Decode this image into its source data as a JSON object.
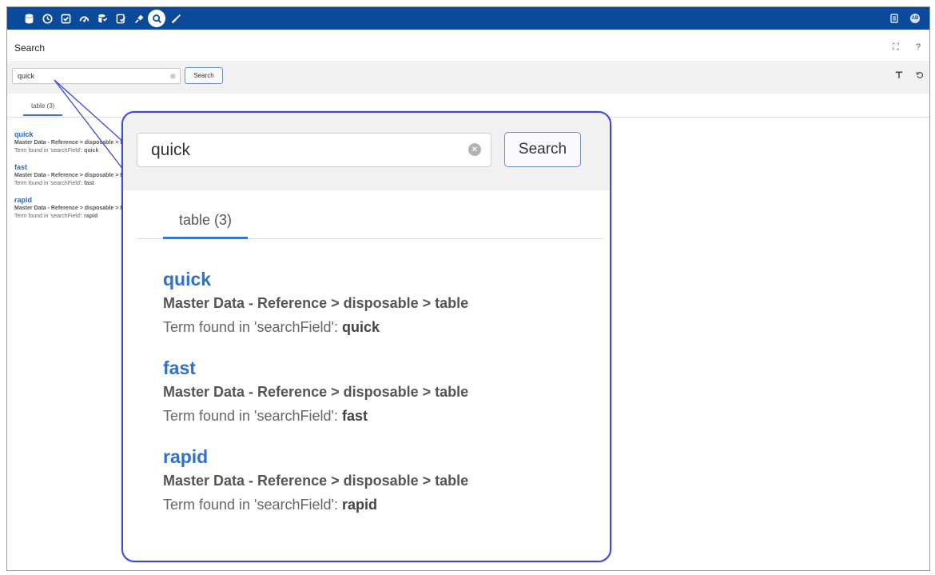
{
  "header": {
    "page_title": "Search",
    "avatar_initials": "AB",
    "nav_icons": [
      "database-icon",
      "clock-icon",
      "checklist-icon",
      "dashboard-icon",
      "data-stack-icon",
      "tasks-icon",
      "plug-icon",
      "search-icon",
      "wrench-icon"
    ],
    "accent": "#0b4a9b"
  },
  "search": {
    "value": "quick",
    "button_label": "Search"
  },
  "tabs": [
    {
      "label": "table (3)"
    }
  ],
  "results": [
    {
      "term": "quick",
      "path": "Master Data - Reference > disposable > table",
      "found_prefix": "Term found in 'searchField':",
      "found_value": "quick"
    },
    {
      "term": "fast",
      "path": "Master Data - Reference > disposable > table",
      "found_prefix": "Term found in 'searchField':",
      "found_value": "fast"
    },
    {
      "term": "rapid",
      "path": "Master Data - Reference > disposable > table",
      "found_prefix": "Term found in 'searchField':",
      "found_value": "rapid"
    }
  ],
  "colors": {
    "link": "#2f6fce",
    "callout_border": "#3b49d8"
  }
}
